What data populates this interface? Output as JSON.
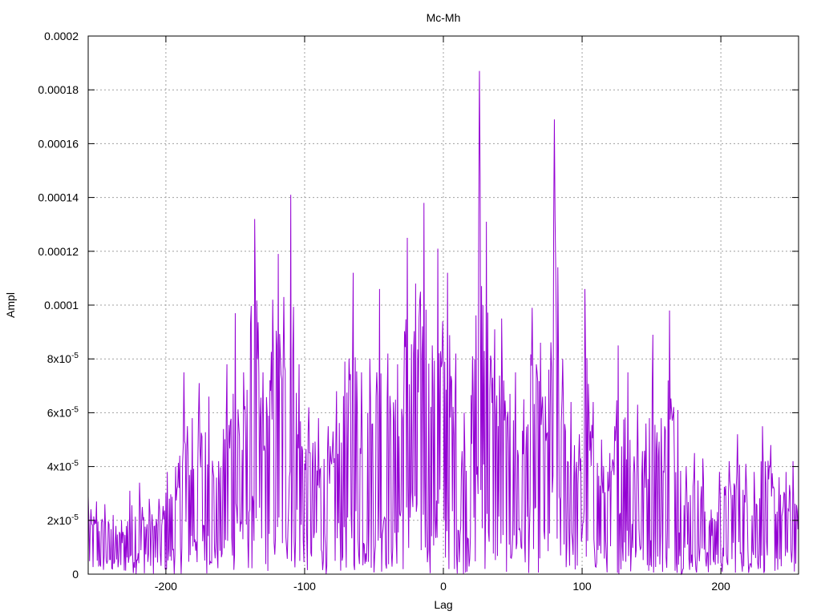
{
  "chart_data": {
    "type": "line",
    "title": "Mc-Mh",
    "xlabel": "Lag",
    "ylabel": "Ampl",
    "xlim": [
      -256,
      256
    ],
    "ylim": [
      0,
      0.0002
    ],
    "grid": true,
    "x_ticks": [
      {
        "value": -200,
        "label": "-200"
      },
      {
        "value": -100,
        "label": "-100"
      },
      {
        "value": 0,
        "label": "0"
      },
      {
        "value": 100,
        "label": "100"
      },
      {
        "value": 200,
        "label": "200"
      }
    ],
    "y_ticks": [
      {
        "value": 0,
        "label": "0",
        "sup": ""
      },
      {
        "value": 2e-05,
        "label": "2x10",
        "sup": "-5"
      },
      {
        "value": 4e-05,
        "label": "4x10",
        "sup": "-5"
      },
      {
        "value": 6e-05,
        "label": "6x10",
        "sup": "-5"
      },
      {
        "value": 8e-05,
        "label": "8x10",
        "sup": "-5"
      },
      {
        "value": 0.0001,
        "label": "0.0001",
        "sup": ""
      },
      {
        "value": 0.00012,
        "label": "0.00012",
        "sup": ""
      },
      {
        "value": 0.00014,
        "label": "0.00014",
        "sup": ""
      },
      {
        "value": 0.00016,
        "label": "0.00016",
        "sup": ""
      },
      {
        "value": 0.00018,
        "label": "0.00018",
        "sup": ""
      },
      {
        "value": 0.0002,
        "label": "0.0002",
        "sup": ""
      }
    ],
    "series": [
      {
        "color": "#9400d3",
        "peaks": [
          [
            -256,
            2.9e-05
          ],
          [
            -250,
            2.7e-05
          ],
          [
            -244,
            2.6e-05
          ],
          [
            -238,
            2.2e-05
          ],
          [
            -232,
            2e-05
          ],
          [
            -226,
            3.1e-05
          ],
          [
            -219,
            3.4e-05
          ],
          [
            -212,
            2.8e-05
          ],
          [
            -205,
            2.8e-05
          ],
          [
            -199,
            3.8e-05
          ],
          [
            -193,
            4e-05
          ],
          [
            -187,
            7.5e-05
          ],
          [
            -181,
            5.8e-05
          ],
          [
            -176,
            7.1e-05
          ],
          [
            -169,
            6.6e-05
          ],
          [
            -162,
            4.2e-05
          ],
          [
            -156,
            7.8e-05
          ],
          [
            -150,
            9.7e-05
          ],
          [
            -144,
            7.5e-05
          ],
          [
            -136,
            0.000132
          ],
          [
            -130,
            7.5e-05
          ],
          [
            -123,
            0.000102
          ],
          [
            -119,
            0.000119
          ],
          [
            -115,
            0.000103
          ],
          [
            -110,
            0.000141
          ],
          [
            -104,
            7.8e-05
          ],
          [
            -97,
            6.2e-05
          ],
          [
            -90,
            5.8e-05
          ],
          [
            -83,
            5.5e-05
          ],
          [
            -77,
            6.8e-05
          ],
          [
            -71,
            7.9e-05
          ],
          [
            -65,
            0.000112
          ],
          [
            -59,
            7.5e-05
          ],
          [
            -53,
            8e-05
          ],
          [
            -46,
            0.000106
          ],
          [
            -40,
            8.2e-05
          ],
          [
            -33,
            7.8e-05
          ],
          [
            -26,
            0.000125
          ],
          [
            -20,
            0.000108
          ],
          [
            -14,
            0.000138
          ],
          [
            -8,
            8.5e-05
          ],
          [
            -4,
            0.000121
          ],
          [
            3,
            0.000112
          ],
          [
            9,
            8.2e-05
          ],
          [
            15,
            6e-05
          ],
          [
            21,
            8.1e-05
          ],
          [
            26,
            0.000187
          ],
          [
            31,
            0.000131
          ],
          [
            37,
            9.1e-05
          ],
          [
            42,
            9.5e-05
          ],
          [
            48,
            6.7e-05
          ],
          [
            52,
            7.5e-05
          ],
          [
            58,
            6.5e-05
          ],
          [
            64,
            9.9e-05
          ],
          [
            70,
            8.6e-05
          ],
          [
            76,
            7.6e-05
          ],
          [
            80,
            0.000169
          ],
          [
            86,
            8e-05
          ],
          [
            92,
            6.4e-05
          ],
          [
            98,
            5.2e-05
          ],
          [
            102,
            0.000106
          ],
          [
            108,
            6.4e-05
          ],
          [
            114,
            5e-05
          ],
          [
            120,
            4.5e-05
          ],
          [
            126,
            8.5e-05
          ],
          [
            133,
            7.5e-05
          ],
          [
            140,
            6.3e-05
          ],
          [
            146,
            5.6e-05
          ],
          [
            151,
            8.9e-05
          ],
          [
            157,
            5.8e-05
          ],
          [
            163,
            9.8e-05
          ],
          [
            169,
            6.1e-05
          ],
          [
            175,
            4e-05
          ],
          [
            181,
            4.5e-05
          ],
          [
            187,
            4.3e-05
          ],
          [
            193,
            2.4e-05
          ],
          [
            199,
            3.8e-05
          ],
          [
            206,
            4.2e-05
          ],
          [
            212,
            5.2e-05
          ],
          [
            218,
            4.1e-05
          ],
          [
            224,
            3.8e-05
          ],
          [
            230,
            5.5e-05
          ],
          [
            236,
            4.8e-05
          ],
          [
            242,
            3.6e-05
          ],
          [
            247,
            3.8e-05
          ],
          [
            252,
            4.2e-05
          ],
          [
            256,
            2.6e-05
          ]
        ]
      }
    ]
  }
}
